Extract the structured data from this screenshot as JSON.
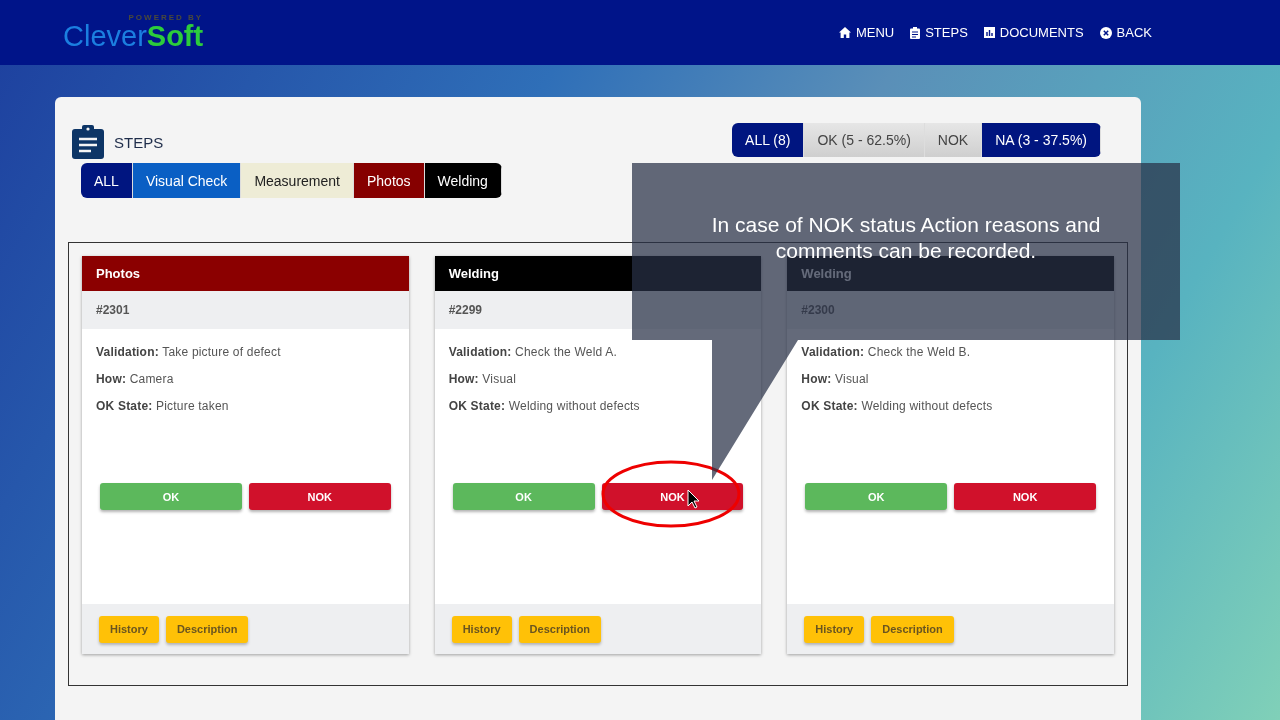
{
  "logo": {
    "powered": "POWERED BY",
    "name_a": "Clever",
    "name_b": "Soft"
  },
  "nav": [
    {
      "kind": "home",
      "label": "MENU"
    },
    {
      "kind": "clipboard",
      "label": "STEPS"
    },
    {
      "kind": "chart",
      "label": "DOCUMENTS"
    },
    {
      "kind": "close",
      "label": "BACK"
    }
  ],
  "title": "STEPS",
  "filters": [
    {
      "label": "ALL (8)",
      "selected": true
    },
    {
      "label": "OK (5 - 62.5%)",
      "selected": false
    },
    {
      "label": "NOK",
      "selected": false
    },
    {
      "label": "NA (3 - 37.5%)",
      "selected": true
    }
  ],
  "categories": [
    {
      "label": "ALL",
      "color": "#001580"
    },
    {
      "label": "Visual Check",
      "color": "#0a5fc4"
    },
    {
      "label": "Measurement",
      "color": "#eeecd6"
    },
    {
      "label": "Photos",
      "color": "#860000"
    },
    {
      "label": "Welding",
      "color": "#000000"
    }
  ],
  "cards": [
    {
      "category": "Photos",
      "kind": "photos",
      "id": "#2301",
      "fields": [
        {
          "label": "Validation:",
          "value": "Take picture of defect"
        },
        {
          "label": "How:",
          "value": "Camera"
        },
        {
          "label": "OK State:",
          "value": "Picture taken"
        }
      ],
      "ok": "OK",
      "nok": "NOK",
      "highlighted": false,
      "footer": [
        "History",
        "Description"
      ]
    },
    {
      "category": "Welding",
      "kind": "welding",
      "id": "#2299",
      "fields": [
        {
          "label": "Validation:",
          "value": "Check the Weld A."
        },
        {
          "label": "How:",
          "value": "Visual"
        },
        {
          "label": "OK State:",
          "value": "Welding without defects"
        }
      ],
      "ok": "OK",
      "nok": "NOK",
      "highlighted": true,
      "footer": [
        "History",
        "Description"
      ]
    },
    {
      "category": "Welding",
      "kind": "welding",
      "id": "#2300",
      "fields": [
        {
          "label": "Validation:",
          "value": "Check the Weld B."
        },
        {
          "label": "How:",
          "value": "Visual"
        },
        {
          "label": "OK State:",
          "value": "Welding without defects"
        }
      ],
      "ok": "OK",
      "nok": "NOK",
      "highlighted": false,
      "footer": [
        "History",
        "Description"
      ]
    }
  ],
  "callout": "In case of NOK status Action reasons and comments can be recorded."
}
